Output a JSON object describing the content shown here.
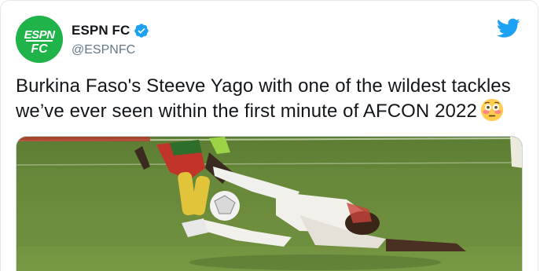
{
  "tweet": {
    "display_name": "ESPN FC",
    "handle": "@ESPNFC",
    "verified": true,
    "text": "Burkina Faso's Steeve Yago with one of the wildest tackles we’ve ever seen within the first minute of AFCON 2022",
    "emoji": "flushed-face",
    "avatar_logo_text": [
      "ESPN",
      "FC"
    ],
    "media": {
      "type": "photo",
      "description_icon": "football-tackle-photo"
    }
  },
  "colors": {
    "avatar_bg": "#1fb34a",
    "twitter_blue": "#1da1f2",
    "verified_blue": "#1da1f2",
    "text_primary": "#14171a",
    "text_secondary": "#657786"
  }
}
